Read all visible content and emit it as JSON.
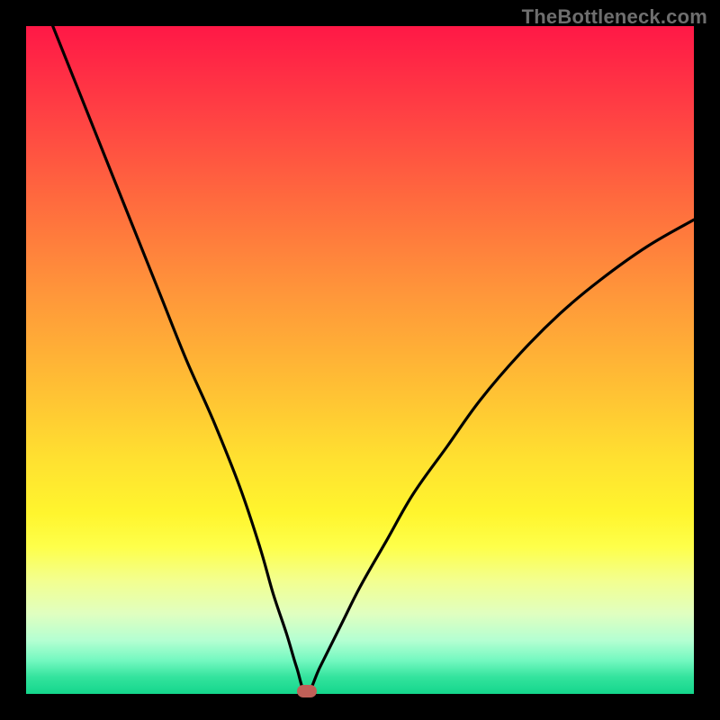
{
  "watermark": "TheBottleneck.com",
  "colors": {
    "frame": "#000000",
    "curve": "#000000",
    "dot": "#c06058",
    "gradient_top": "#ff1846",
    "gradient_bottom": "#14d68c"
  },
  "chart_data": {
    "type": "line",
    "title": "",
    "xlabel": "",
    "ylabel": "",
    "xlim": [
      0,
      100
    ],
    "ylim": [
      0,
      100
    ],
    "grid": false,
    "legend": false,
    "annotations": [
      {
        "kind": "marker",
        "x": 42,
        "y": 0,
        "shape": "pill",
        "color": "#c06058"
      }
    ],
    "note": "V-shaped bottleneck curve; axes have no visible tick labels. Values inferred from curve geometry (0 = bottom/left, 100 = top/right).",
    "series": [
      {
        "name": "bottleneck-curve",
        "color": "#000000",
        "x": [
          4,
          8,
          12,
          16,
          20,
          24,
          28,
          32,
          35,
          37,
          39,
          40.5,
          42,
          44,
          47,
          50,
          54,
          58,
          63,
          68,
          74,
          80,
          86,
          93,
          100
        ],
        "y": [
          100,
          90,
          80,
          70,
          60,
          50,
          41,
          31,
          22,
          15,
          9,
          4,
          0,
          4,
          10,
          16,
          23,
          30,
          37,
          44,
          51,
          57,
          62,
          67,
          71
        ]
      }
    ]
  }
}
